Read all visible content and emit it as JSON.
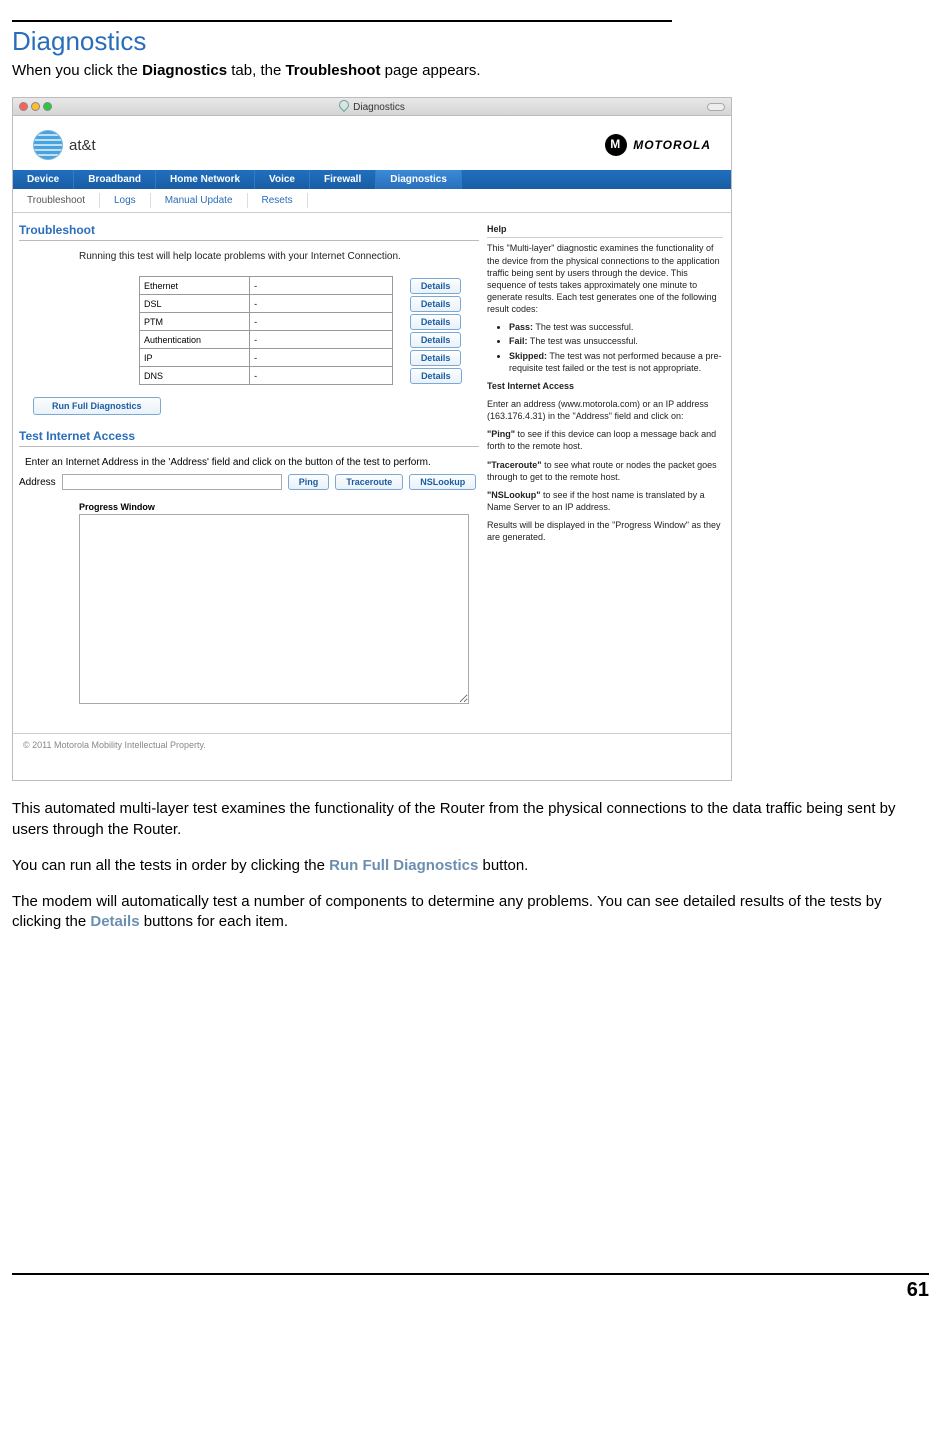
{
  "doc": {
    "heading": "Diagnostics",
    "intro_pre": "When you click the ",
    "intro_bold1": "Diagnostics",
    "intro_mid": " tab, the ",
    "intro_bold2": "Troubleshoot",
    "intro_post": " page appears.",
    "para2": "This automated multi-layer test examines the functionality of the Router from the physical connections to the data traffic being sent by users through the Router.",
    "para3_pre": "You can run all the tests in order by clicking the ",
    "para3_link": "Run Full Diagnostics",
    "para3_post": " button.",
    "para4_pre": "The modem will automatically test a number of components to determine any problems. You can see detailed results of the tests by clicking the ",
    "para4_link": "Details",
    "para4_post": " buttons for each item.",
    "page_number": "61"
  },
  "window": {
    "title": "Diagnostics",
    "brand_att": "at&t",
    "brand_moto": "MOTOROLA",
    "nav1": {
      "i0": "Device",
      "i1": "Broadband",
      "i2": "Home Network",
      "i3": "Voice",
      "i4": "Firewall",
      "i5": "Diagnostics"
    },
    "nav2": {
      "i0": "Troubleshoot",
      "i1": "Logs",
      "i2": "Manual Update",
      "i3": "Resets"
    },
    "section_troubleshoot": "Troubleshoot",
    "running_text": "Running this test will help locate problems with your Internet Connection.",
    "diag_rows": {
      "r0": "Ethernet",
      "r1": "DSL",
      "r2": "PTM",
      "r3": "Authentication",
      "r4": "IP",
      "r5": "DNS"
    },
    "dash": "-",
    "details_btn": "Details",
    "run_full": "Run Full Diagnostics",
    "section_tia": "Test Internet Access",
    "tia_instr": "Enter an Internet Address in the 'Address' field and click on the button of the test to perform.",
    "address_label": "Address",
    "ping": "Ping",
    "traceroute": "Traceroute",
    "nslookup": "NSLookup",
    "progress_label": "Progress Window",
    "footer": "© 2011 Motorola Mobility Intellectual Property."
  },
  "help": {
    "title": "Help",
    "p1": "This \"Multi-layer\" diagnostic examines the functionality of the device from the physical connections to the application traffic being sent by users through the device. This sequence of tests takes approximately one minute to generate results. Each test generates one of the following result codes:",
    "li_pass_b": "Pass:",
    "li_pass": " The test was successful.",
    "li_fail_b": "Fail:",
    "li_fail": " The test was unsuccessful.",
    "li_skip_b": "Skipped:",
    "li_skip": " The test was not performed because a pre-requisite test failed or the test is not appropriate.",
    "h_tia": "Test Internet Access",
    "p2": "Enter an address (www.motorola.com) or an IP address (163.176.4.31) in the \"Address\" field and click on:",
    "p_ping_b": "\"Ping\"",
    "p_ping": " to see if this device can loop a message back and forth to the remote host.",
    "p_tr_b": "\"Traceroute\"",
    "p_tr": " to see what route or nodes the packet goes through to get to the remote host.",
    "p_ns_b": "\"NSLookup\"",
    "p_ns": " to see if the host name is translated by a Name Server to an IP address.",
    "p3": "Results will be displayed in the \"Progress Window\" as they are generated."
  }
}
